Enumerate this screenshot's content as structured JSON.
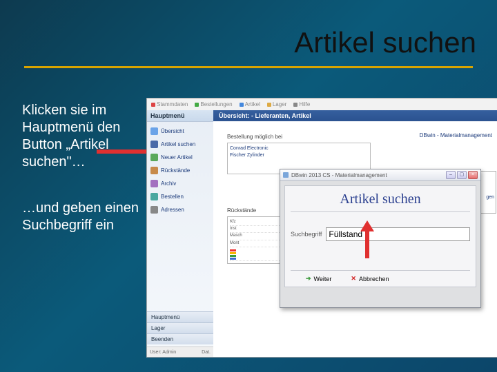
{
  "slide": {
    "title": "Artikel suchen",
    "paragraph1": "Klicken sie im Hauptmenü den Button „Artikel suchen\"…",
    "paragraph2": "…und geben einen Suchbegriff ein"
  },
  "app": {
    "toolbar": [
      "Stammdaten",
      "Bestellungen",
      "Artikel",
      "Lager",
      "Hilfe"
    ],
    "brand": "DBwin - Materialmanagement",
    "sidebar": {
      "header": "Hauptmenü",
      "items": [
        {
          "icon": "overview-icon",
          "color": "#6aa3e8",
          "label": "Übersicht"
        },
        {
          "icon": "search-icon",
          "color": "#4a6aa8",
          "label": "Artikel suchen"
        },
        {
          "icon": "new-icon",
          "color": "#5aa85a",
          "label": "Neuer Artikel"
        },
        {
          "icon": "back-icon",
          "color": "#c78a4a",
          "label": "Rückstände"
        },
        {
          "icon": "archive-icon",
          "color": "#a370c0",
          "label": "Archiv"
        },
        {
          "icon": "order-icon",
          "color": "#4aa8a0",
          "label": "Bestellen"
        },
        {
          "icon": "address-icon",
          "color": "#888",
          "label": "Adressen"
        }
      ],
      "bottom": [
        "Hauptmenü",
        "Lager",
        "Beenden"
      ],
      "status_left": "User: Admin",
      "status_right": "Dat."
    },
    "main": {
      "header": "Übersicht: - Lieferanten, Artikel",
      "label_suppliers": "Bestellung möglich bei",
      "suppliers": [
        "Conrad Electronic",
        "Fischer Zylinder"
      ],
      "label_returns": "Rückstände",
      "returns_rows": [
        "Kfz",
        "Inst",
        "Masch",
        "Mont"
      ],
      "bar_colors": [
        "#e33",
        "#f7b500",
        "#3a9a3a",
        "#3a6ad0"
      ]
    }
  },
  "dialog": {
    "window_title": "DBwin 2013 CS - Materialmanagement",
    "title": "Artikel suchen",
    "search_label": "Suchbegriff",
    "search_value": "Füllstand",
    "btn_next": "Weiter",
    "btn_cancel": "Abbrechen"
  },
  "peek": {
    "frag1": "ߓ",
    "frag2": "gen"
  }
}
